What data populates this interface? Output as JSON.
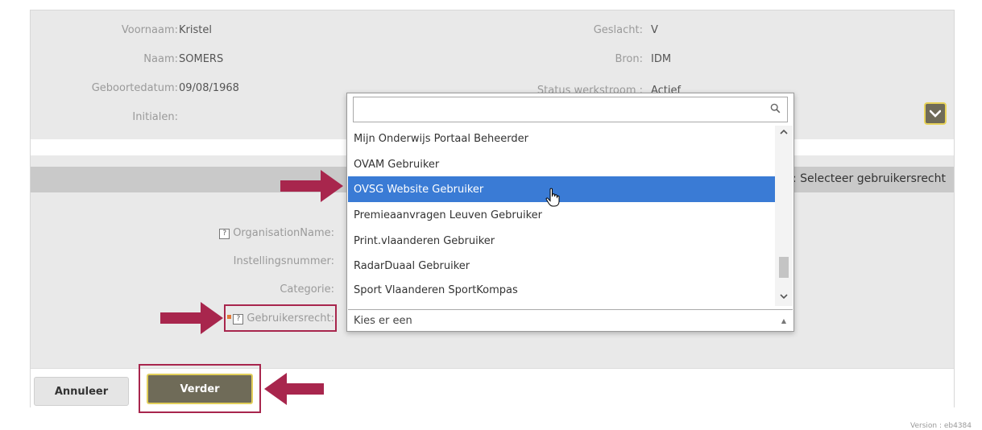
{
  "person": {
    "voornaam_label": "Voornaam:",
    "voornaam_value": "Kristel",
    "naam_label": "Naam:",
    "naam_value": "SOMERS",
    "geboortedatum_label": "Geboortedatum:",
    "geboortedatum_value": "09/08/1968",
    "initialen_label": "Initialen:",
    "geslacht_label": "Geslacht:",
    "geslacht_value": "V",
    "bron_label": "Bron:",
    "bron_value": "IDM",
    "status_label": "Status werkstroom :",
    "status_value": "Actief"
  },
  "step": {
    "text": "3: Selecteer gebruikersrecht"
  },
  "form": {
    "organisation_label": "OrganisationName:",
    "instellingsnummer_label": "Instellingsnummer:",
    "categorie_label": "Categorie:",
    "gebruikersrecht_label": "Gebruikersrecht:",
    "help_glyph": "?"
  },
  "dropdown": {
    "search_value": "",
    "options": [
      "Mijn Onderwijs Portaal Beheerder",
      "OVAM Gebruiker",
      "OVSG Website Gebruiker",
      "Premieaanvragen Leuven Gebruiker",
      "Print.vlaanderen Gebruiker",
      "RadarDuaal Gebruiker",
      "Sport Vlaanderen SportKompas"
    ],
    "selected_index": 2,
    "select_placeholder": "Kies er een"
  },
  "buttons": {
    "annuleer": "Annuleer",
    "verder": "Verder"
  },
  "version_text": "Version : eb4384",
  "colors": {
    "accent_dark": "#6f6b58",
    "accent_border": "#e2cf5a",
    "highlight": "#a8264d",
    "selected_option": "#3a7bd5"
  },
  "icons": {
    "search": "search-icon",
    "chevron": "chevron-down-icon",
    "arrow": "arrow-right-icon"
  }
}
